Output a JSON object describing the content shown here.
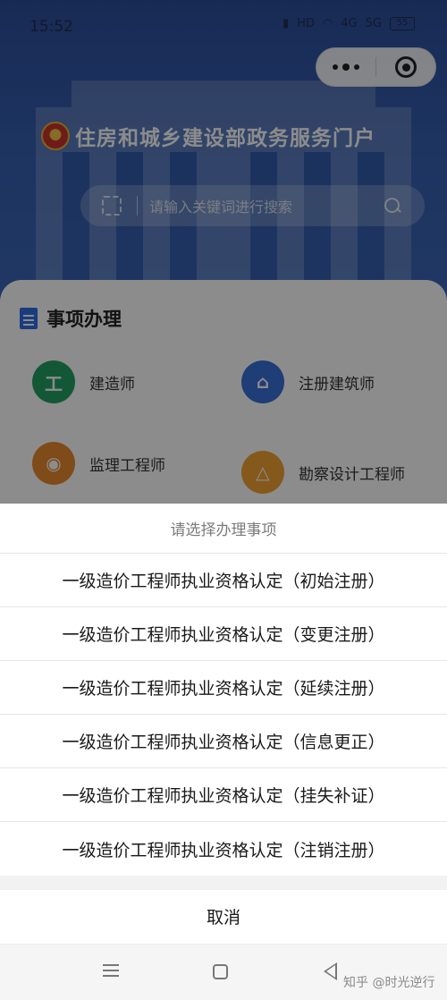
{
  "status_bar": {
    "time": "15:52",
    "hd_label": "HD",
    "signal_1": "4G",
    "signal_2": "5G",
    "battery": "55"
  },
  "portal": {
    "title": "住房和城乡建设部政务服务门户",
    "search_placeholder": "请输入关键词进行搜索"
  },
  "section": {
    "title": "事项办理",
    "items": [
      {
        "label": "建造师",
        "icon": "builder-icon",
        "color": "#23a063"
      },
      {
        "label": "注册建筑师",
        "icon": "architect-icon",
        "color": "#3a6fd8"
      },
      {
        "label": "监理工程师",
        "icon": "supervisor-icon",
        "color": "#e8892e"
      },
      {
        "label": "勘察设计工程师",
        "icon": "survey-icon",
        "color": "#f0a332"
      }
    ]
  },
  "action_sheet": {
    "title": "请选择办理事项",
    "options": [
      "一级造价工程师执业资格认定（初始注册）",
      "一级造价工程师执业资格认定（变更注册）",
      "一级造价工程师执业资格认定（延续注册）",
      "一级造价工程师执业资格认定（信息更正）",
      "一级造价工程师执业资格认定（挂失补证）",
      "一级造价工程师执业资格认定（注销注册）"
    ],
    "cancel": "取消"
  },
  "watermark": "知乎 @时光逆行",
  "colors": {
    "hero_blue": "#365fb0",
    "accent_blue": "#2f6ee6"
  }
}
